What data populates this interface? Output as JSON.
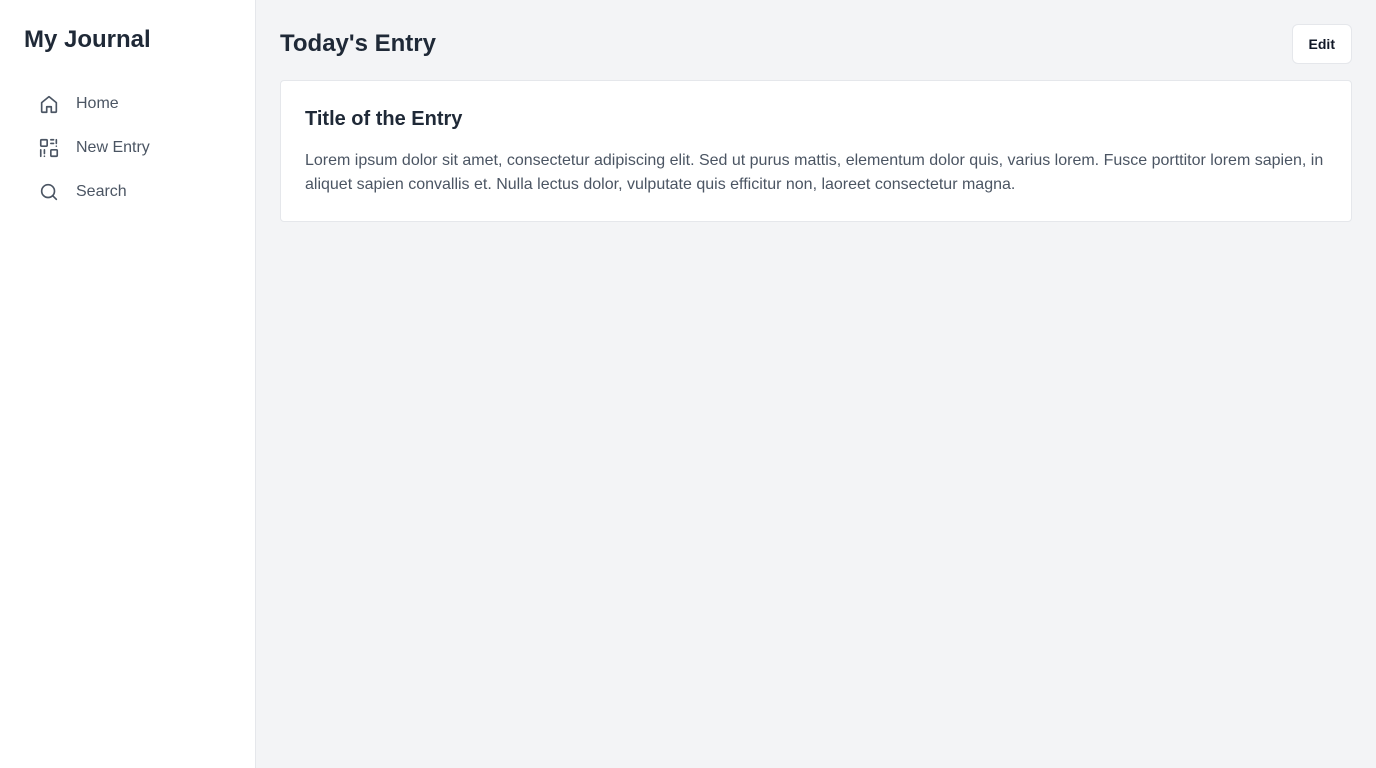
{
  "sidebar": {
    "app_title": "My Journal",
    "items": [
      {
        "label": "Home",
        "icon": "home-icon"
      },
      {
        "label": "New Entry",
        "icon": "new-entry-icon"
      },
      {
        "label": "Search",
        "icon": "search-icon"
      }
    ]
  },
  "header": {
    "title": "Today's Entry",
    "edit_label": "Edit"
  },
  "entry": {
    "title": "Title of the Entry",
    "body": "Lorem ipsum dolor sit amet, consectetur adipiscing elit. Sed ut purus mattis, elementum dolor quis, varius lorem. Fusce porttitor lorem sapien, in aliquet sapien convallis et. Nulla lectus dolor, vulputate quis efficitur non, laoreet consectetur magna."
  },
  "colors": {
    "background": "#f3f4f6",
    "sidebar": "#ffffff",
    "text_primary": "#1f2937",
    "text_secondary": "#4b5563",
    "border": "#e5e7eb"
  }
}
